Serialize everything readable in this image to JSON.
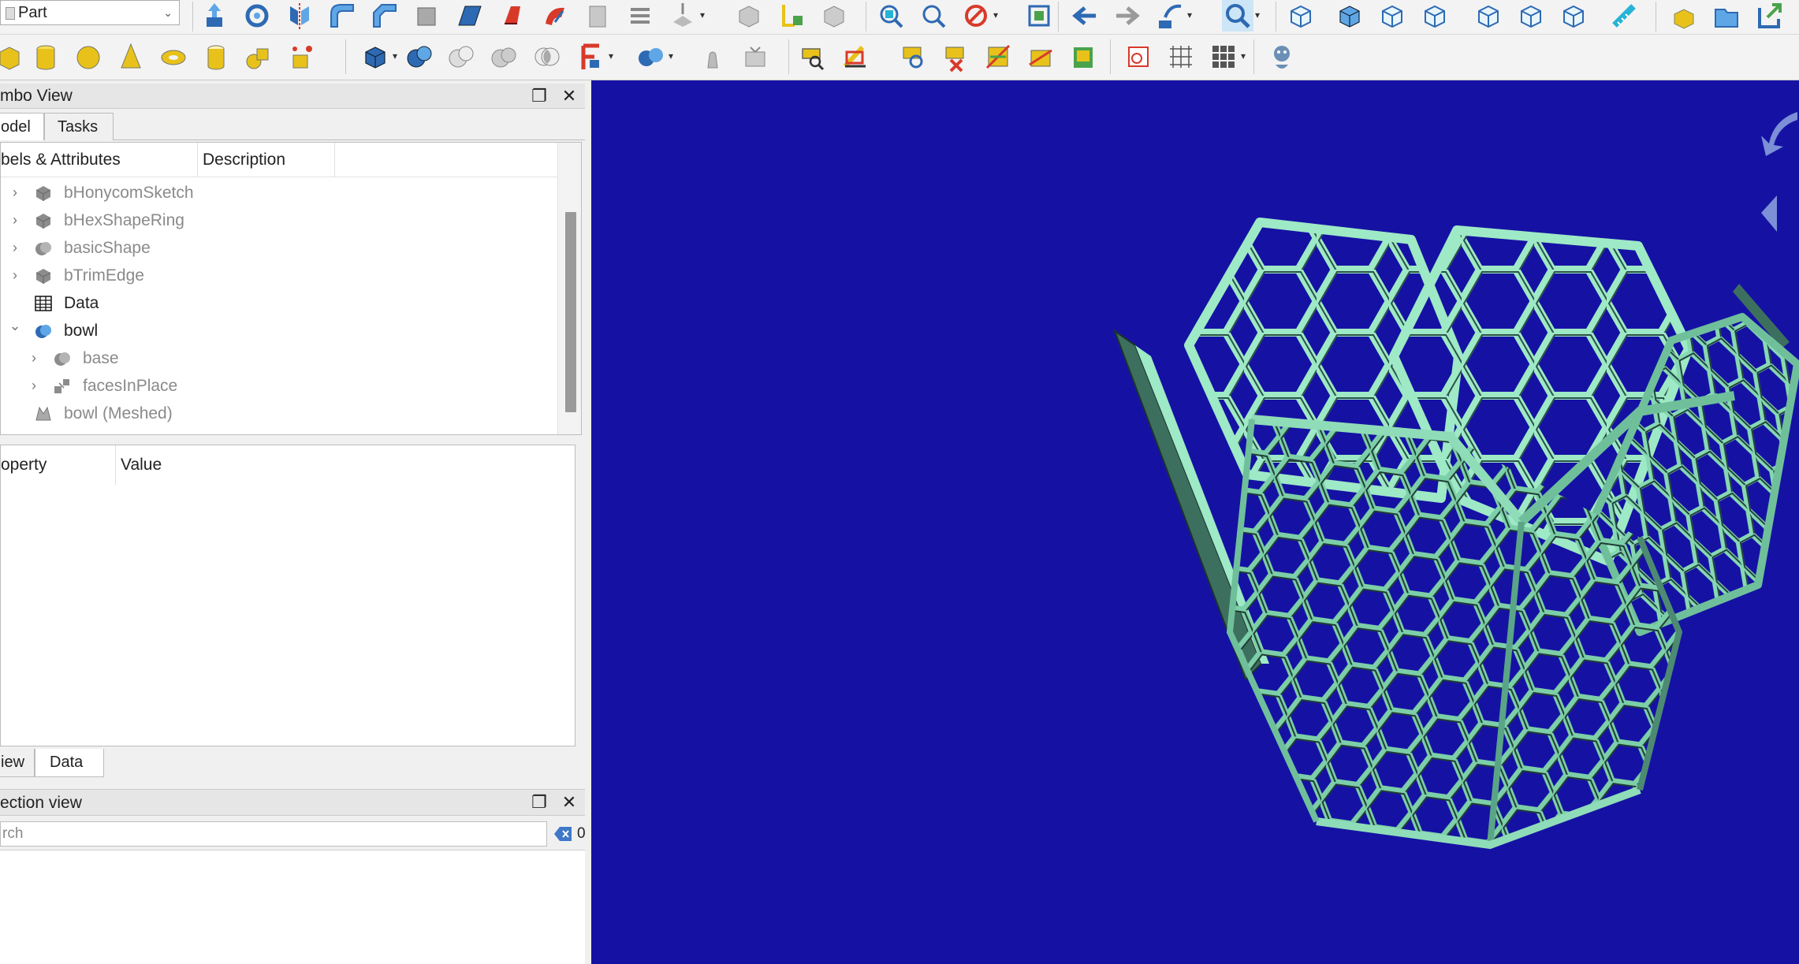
{
  "toolbar": {
    "workbench_selector": {
      "value": "Part",
      "icon": "part-workbench-icon"
    },
    "accent_color": "#2e6ab3"
  },
  "combo_view": {
    "title": "mbo View",
    "tabs": [
      "odel",
      "Tasks"
    ],
    "tree_columns": [
      "bels & Attributes",
      "Description"
    ],
    "tree_items": [
      {
        "label": "bHonycomSketch",
        "icon": "part-feature-icon",
        "expandable": true,
        "expanded": false,
        "depth": 0,
        "hidden": true
      },
      {
        "label": "bHexShapeRing",
        "icon": "part-feature-icon",
        "expandable": true,
        "expanded": false,
        "depth": 0,
        "hidden": true
      },
      {
        "label": "basicShape",
        "icon": "boolean-icon",
        "expandable": true,
        "expanded": false,
        "depth": 0,
        "hidden": true
      },
      {
        "label": "bTrimEdge",
        "icon": "part-feature-icon",
        "expandable": true,
        "expanded": false,
        "depth": 0,
        "hidden": true
      },
      {
        "label": "Data",
        "icon": "spreadsheet-icon",
        "expandable": false,
        "expanded": false,
        "depth": 0,
        "hidden": false
      },
      {
        "label": "bowl",
        "icon": "boolean-fusion-icon",
        "expandable": true,
        "expanded": true,
        "depth": 0,
        "hidden": false
      },
      {
        "label": "base",
        "icon": "boolean-icon",
        "expandable": true,
        "expanded": false,
        "depth": 1,
        "hidden": true
      },
      {
        "label": "facesInPlace",
        "icon": "shapebinder-icon",
        "expandable": true,
        "expanded": false,
        "depth": 1,
        "hidden": true
      },
      {
        "label": "bowl (Meshed)",
        "icon": "mesh-icon",
        "expandable": false,
        "expanded": false,
        "depth": 0,
        "hidden": true
      }
    ],
    "property_columns": [
      "operty",
      "Value"
    ],
    "bottom_tabs": [
      "iew",
      "Data"
    ]
  },
  "selection_view": {
    "title": "ection view",
    "search_placeholder": "rch",
    "count": "0"
  },
  "viewport": {
    "background": "#1512a3",
    "model_color": "#9ee9c6"
  }
}
